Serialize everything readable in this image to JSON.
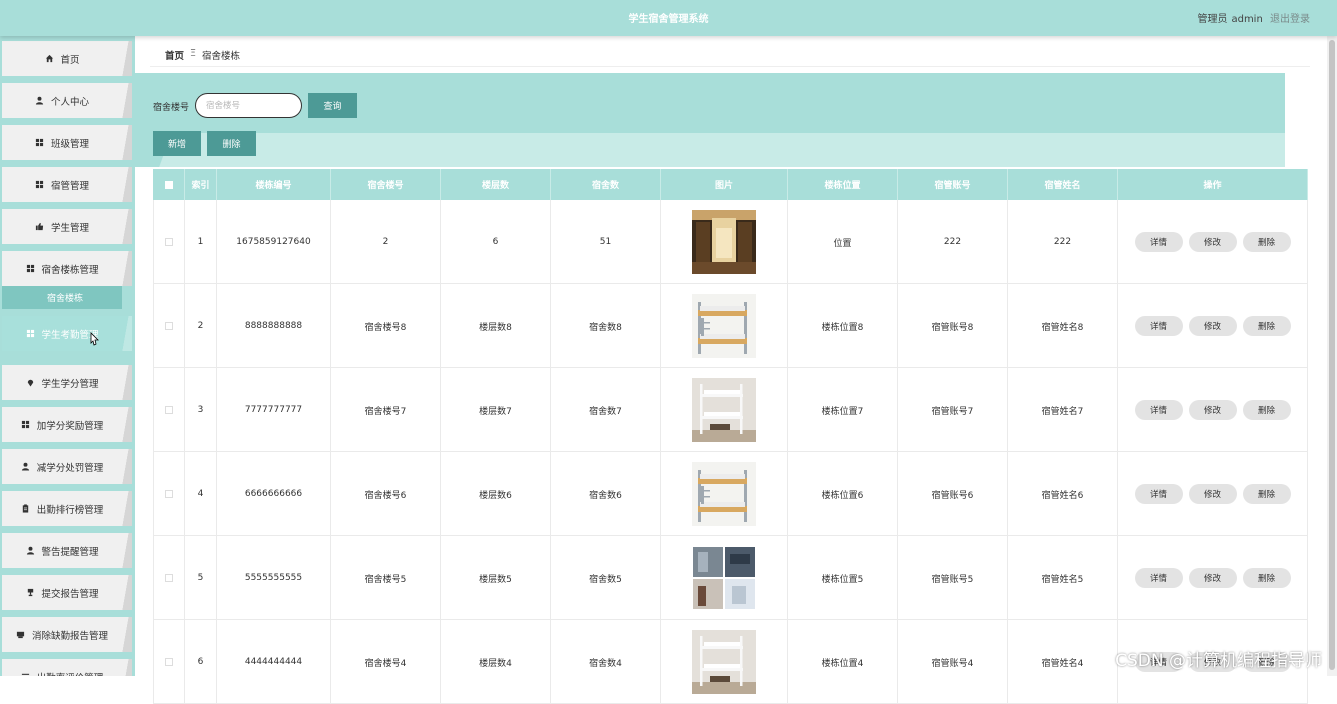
{
  "header": {
    "title": "学生宿舍管理系统",
    "user_role": "管理员",
    "user_name": "admin",
    "logout": "退出登录"
  },
  "colors": {
    "accent": "#a8ded9",
    "button": "#4d9a96",
    "submenu": "#7fc6c0"
  },
  "sidebar": {
    "items": [
      {
        "label": "首页",
        "icon": "home-icon"
      },
      {
        "label": "个人中心",
        "icon": "user-icon"
      },
      {
        "label": "班级管理",
        "icon": "grid-icon"
      },
      {
        "label": "宿管管理",
        "icon": "grid-icon"
      },
      {
        "label": "学生管理",
        "icon": "thumb-icon"
      },
      {
        "label": "宿舍楼栋管理",
        "icon": "grid-icon"
      },
      {
        "label": "学生考勤管理",
        "icon": "grid-icon"
      },
      {
        "label": "学生学分管理",
        "icon": "pin-icon"
      },
      {
        "label": "加学分奖励管理",
        "icon": "grid-icon"
      },
      {
        "label": "减学分处罚管理",
        "icon": "user-icon"
      },
      {
        "label": "出勤排行榜管理",
        "icon": "clipboard-icon"
      },
      {
        "label": "警告提醒管理",
        "icon": "user-icon"
      },
      {
        "label": "提交报告管理",
        "icon": "trophy-icon"
      },
      {
        "label": "消除缺勤报告管理",
        "icon": "printer-icon"
      },
      {
        "label": "出勤率评价管理",
        "icon": "list-icon"
      }
    ],
    "sub_item": "宿舍楼栋"
  },
  "breadcrumb": {
    "home": "首页",
    "separator": "Ξ",
    "current": "宿舍楼栋"
  },
  "search": {
    "label": "宿舍楼号",
    "placeholder": "宿舍楼号",
    "query_button": "查询"
  },
  "actions": {
    "add": "新增",
    "delete": "删除"
  },
  "table": {
    "headers": [
      "索引",
      "楼栋编号",
      "宿舍楼号",
      "楼层数",
      "宿舍数",
      "图片",
      "楼栋位置",
      "宿管账号",
      "宿管姓名",
      "操作"
    ],
    "ops": [
      "详情",
      "修改",
      "删除"
    ],
    "rows": [
      {
        "index": "1",
        "code": "1675859127640",
        "building": "2",
        "floors": "6",
        "rooms": "51",
        "image": "hall",
        "location": "位置",
        "account": "222",
        "name": "222"
      },
      {
        "index": "2",
        "code": "8888888888",
        "building": "宿舍楼号8",
        "floors": "楼层数8",
        "rooms": "宿舍数8",
        "image": "bunk-wood",
        "location": "楼栋位置8",
        "account": "宿管账号8",
        "name": "宿管姓名8"
      },
      {
        "index": "3",
        "code": "7777777777",
        "building": "宿舍楼号7",
        "floors": "楼层数7",
        "rooms": "宿舍数7",
        "image": "bunk-white",
        "location": "楼栋位置7",
        "account": "宿管账号7",
        "name": "宿管姓名7"
      },
      {
        "index": "4",
        "code": "6666666666",
        "building": "宿舍楼号6",
        "floors": "楼层数6",
        "rooms": "宿舍数6",
        "image": "bunk-wood",
        "location": "楼栋位置6",
        "account": "宿管账号6",
        "name": "宿管姓名6"
      },
      {
        "index": "5",
        "code": "5555555555",
        "building": "宿舍楼号5",
        "floors": "楼层数5",
        "rooms": "宿舍数5",
        "image": "collage",
        "location": "楼栋位置5",
        "account": "宿管账号5",
        "name": "宿管姓名5"
      },
      {
        "index": "6",
        "code": "4444444444",
        "building": "宿舍楼号4",
        "floors": "楼层数4",
        "rooms": "宿舍数4",
        "image": "bunk-white",
        "location": "楼栋位置4",
        "account": "宿管账号4",
        "name": "宿管姓名4"
      }
    ]
  },
  "watermark": "CSDN @计算机编程指导师"
}
